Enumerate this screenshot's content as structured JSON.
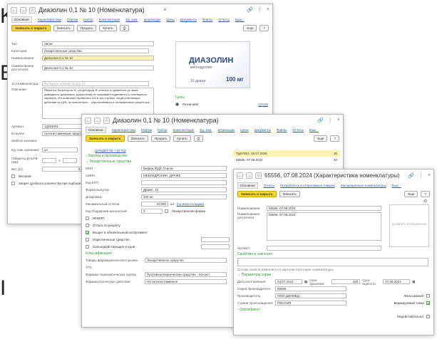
{
  "bg_letters": [
    "K",
    "",
    "B",
    "",
    "",
    "",
    "",
    "",
    "I"
  ],
  "w1": {
    "title": "Диазолин 0,1 № 10 (Номенклатура)",
    "tabs": [
      "Основное",
      "Характеристики",
      "Партии",
      "Набор",
      "Комплектация",
      "Ед. изм.",
      "Штрихкоды",
      "Цены",
      "Документы",
      "Файлы",
      "Отчеты",
      "Еще..."
    ],
    "btn_write_close": "Записать и закрыть",
    "btn_write": "Записать",
    "btn_sell": "Продать",
    "btn_buy": "Купить",
    "btn_more": "Еще",
    "help": "?",
    "type_label": "Тип:",
    "type_val": "Запас",
    "cat_label": "Категория:",
    "cat_val": "Лекарственные средства",
    "name_label": "Наименование:",
    "name_val": "Диазолин 0,1 № 10",
    "print_label": "Наименование для печати:",
    "print_val": "Диазолин 0,1 № 10",
    "onec_label": "1С Номенклатура:",
    "onec_val": "Выберите номенклатуру 1С",
    "desc_label": "Описание:",
    "desc_val": "Является блокатором Н - рецепторов. В отличие от димебона (и также димедрола, дипразина, супрастина) не оказывает седативного и снотворного эффекта, что позволяет применять его в тех случаях, когда угнетающее действие на ЦНС не желательно... серотонинового и гистаминового рецептора...",
    "art_label": "Артикул:",
    "art_val": "12004001",
    "group_label": "В группе:",
    "group_val": "Антигистаминные средства",
    "sku_label": "Шаблон ценника:",
    "unit_label": "Ед. изм. хранения:",
    "unit_val": "шт",
    "dim_label": "Габариты Д×Ш×В (мм):",
    "weight_label": "Вес (кг):",
    "weight_val": "0,000",
    "excise_label": "Весовой",
    "restrict_label": "Запрет дробного количества при подборе",
    "prices_label": "Цены",
    "price_kind": "Розничная",
    "price_val": "215,00",
    "pack_brand": "ДИАЗОЛИН",
    "pack_sub": "мебгидролин",
    "pack_dose": "100 мг",
    "pack_count": "10 драже"
  },
  "w2": {
    "title": "Диазолин 0,1 № 10 (Номенклатура)",
    "tabs": [
      "Основное",
      "Характеристики",
      "Партии",
      "Набор",
      "Комплектация",
      "Ед. изм.",
      "Штрихкоды",
      "Цены",
      "Документы",
      "Файлы",
      "Отчеты",
      "Еще..."
    ],
    "btn_write_close": "Записать и закрыть",
    "btn_write": "Записать",
    "btn_sell": "Продать",
    "btn_buy": "Купить",
    "btn_more": "Еще",
    "help": "?",
    "small_link": "ЦИНДИТ 00, +10 ЮЗ",
    "sec_purchase": "Закупка и производство",
    "sec_drug": "Лекарственные средства",
    "mnn_label": "МНН:",
    "mnn_val": "Бифид ЖДЗ 7/сигов",
    "smnn_label": "СМНН:",
    "smnn_val": "МЕБГИДРОЛИН. ДРАЖЕ",
    "klp_label": "Код КЛП:",
    "form_label": "Форма выпуска:",
    "form_val": "Драже, 10",
    "dose_label": "Дозировка:",
    "dose_val": "100 мг",
    "min_label": "Минимальный остаток:",
    "min_val": "10,000",
    "min_unit": "шт",
    "min_link": "(по всем складам)",
    "code_label": "Код Поддержки дисконтной:",
    "code_val": "0",
    "lek_form": "Лекарственная форма",
    "c1": "ЖНВЛП",
    "c2": "Отпуск по рецепту",
    "c3": "Входит в обязательный ассортимент",
    "c4": "Наркотическое средство",
    "c5": "Сильнодействующее и ядов",
    "sec_class": "Классификация",
    "trp_label": "Товары фармацевтического рынка:",
    "trp_val": "Лекарственное средство",
    "atx_label": "АТХ:",
    "ftg_label": "Фармако-терапевтическая группа:",
    "ftg_val": "Противоаллергическое средство - Н1-гист",
    "pd_label": "Фармакологическое действие:",
    "pd_val": "Н1-антигистаминное",
    "lots": [
      {
        "name": "ТЦ07803, 26.07.2025",
        "qty": "10"
      },
      {
        "name": "65556, 07.08.2024",
        "qty": "20"
      }
    ]
  },
  "w3": {
    "title": "65556, 07.08.2024 (Характеристика номенклатуры)",
    "tabs": [
      "Основное",
      "Отчеты",
      "Потребность в отпускаемых товарах",
      "Распределение номенклатуры",
      "Еще..."
    ],
    "btn_write_close": "Записать и закрыть",
    "btn_write": "Записать",
    "btn_more": "Еще",
    "help": "?",
    "name_label": "Наименование:",
    "name_val": "65556, 07.08.2024",
    "print_label": "Наименование для печати:",
    "print_val": "65556, 07.08.2024",
    "art_label": "Артикул:",
    "photo_hint": "Добавить изображение",
    "sec_props": "Свойства и значения",
    "props_note": "Состав свойств изменяется в карточке Категория номенклатуры",
    "sec_params": "Параметры серии",
    "date_label": "Дата изготовления:",
    "date_val": "04.07.2023",
    "term_label": "Срок хранения:",
    "term_val": "400",
    "valid_label": "Срок годности:",
    "valid_val": "07.08.2024",
    "series_label": "Серия производителя:",
    "series_val": "65656",
    "maker_label": "Производитель:",
    "maker_val": "ООО ДИАМЕД",
    "falsified": "Фальсификат",
    "country_label": "Страна происхождения:",
    "country_val": "РОССИЯ",
    "marked": "Маркируемый товар",
    "sec_cert": "Сертификат",
    "bottom": "Недействительна:"
  }
}
